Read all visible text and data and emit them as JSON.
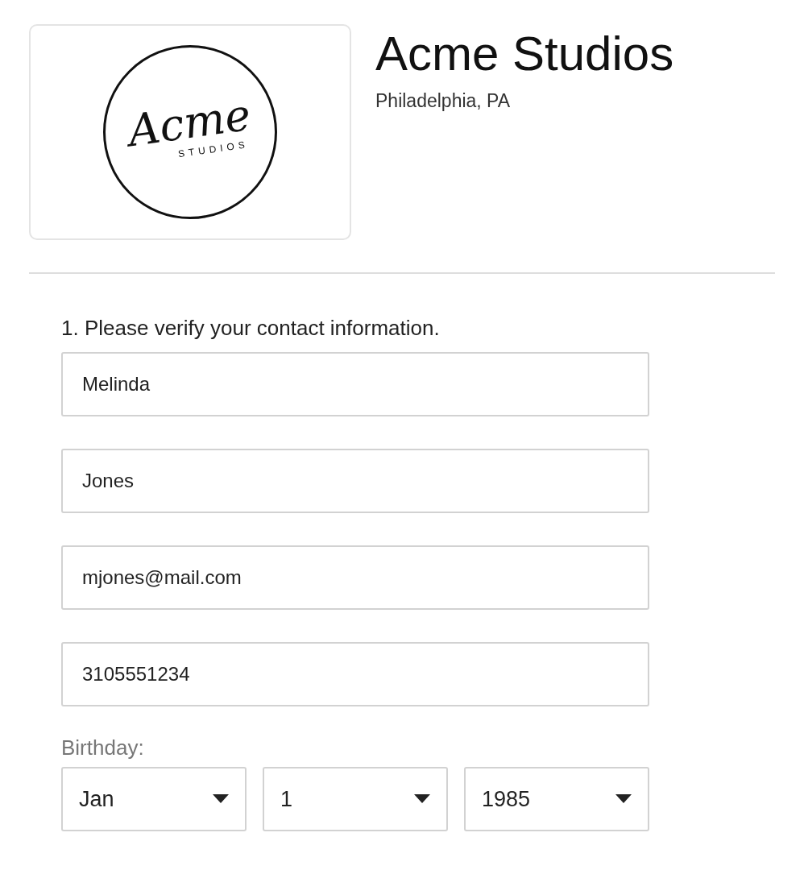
{
  "logo": {
    "script": "Acme",
    "subtitle": "STUDIOS"
  },
  "business": {
    "name": "Acme Studios",
    "location": "Philadelphia, PA"
  },
  "form": {
    "heading": "1. Please verify your contact information.",
    "fields": [
      {
        "value": "Melinda"
      },
      {
        "value": "Jones"
      },
      {
        "value": "mjones@mail.com"
      },
      {
        "value": "3105551234"
      }
    ],
    "birthday": {
      "label": "Birthday:",
      "selects": [
        {
          "value": "Jan"
        },
        {
          "value": "1"
        },
        {
          "value": "1985"
        }
      ]
    }
  }
}
